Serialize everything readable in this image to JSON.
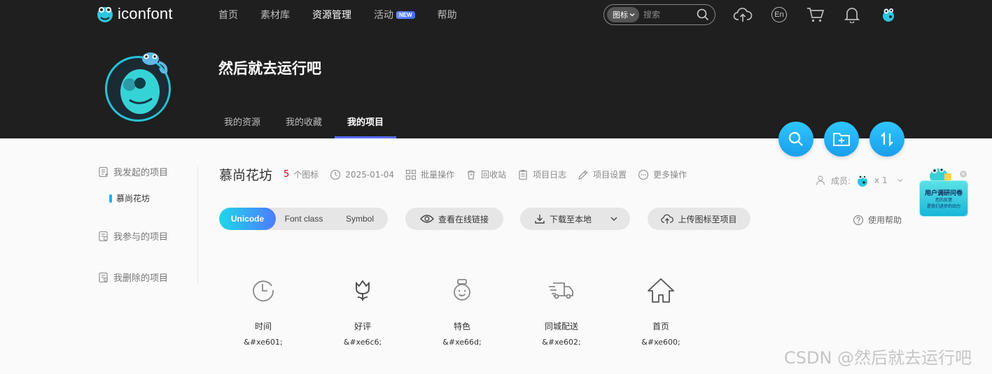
{
  "nav": {
    "logo_text": "iconfont",
    "links": [
      {
        "label": "首页"
      },
      {
        "label": "素材库"
      },
      {
        "label": "资源管理"
      },
      {
        "label": "活动",
        "badge": "NEW"
      },
      {
        "label": "帮助"
      }
    ],
    "search": {
      "type_label": "图标",
      "placeholder": "搜索"
    },
    "lang_label": "En"
  },
  "profile": {
    "name": "然后就去运行吧",
    "tabs": [
      "我的资源",
      "我的收藏",
      "我的项目"
    ],
    "active_tab": "我的项目"
  },
  "sidebar": {
    "started": "我发起的项目",
    "project_item": "慕尚花坊",
    "joined": "我参与的项目",
    "deleted": "我删除的项目"
  },
  "project": {
    "title": "慕尚花坊",
    "icon_count": "5",
    "icon_count_suffix": "个图标",
    "date": "2025-01-04",
    "actions": [
      "批量操作",
      "回收站",
      "项目日志",
      "项目设置",
      "更多操作"
    ]
  },
  "members": {
    "label": "成员:",
    "count": "x 1"
  },
  "help_label": "使用帮助",
  "toolbar": {
    "formats": [
      "Unicode",
      "Font class",
      "Symbol"
    ],
    "active_format": "Unicode",
    "view_link": "查看在线链接",
    "download": "下载至本地",
    "upload": "上传图标至项目"
  },
  "icons": [
    {
      "name": "时间",
      "code": "&#xe601;",
      "icon": "clock-icon"
    },
    {
      "name": "好评",
      "code": "&#xe6c6;",
      "icon": "tulip-icon"
    },
    {
      "name": "特色",
      "code": "&#xe66d;",
      "icon": "medal-face-icon"
    },
    {
      "name": "同城配送",
      "code": "&#xe602;",
      "icon": "delivery-truck-icon"
    },
    {
      "name": "首页",
      "code": "&#xe600;",
      "icon": "home-icon"
    }
  ],
  "survey": {
    "title": "用户调研问卷",
    "line1": "您的反馈",
    "line2": "是我们进步的动力"
  },
  "watermark": "CSDN @然后就去运行吧",
  "colors": {
    "header_bg": "#1f1f1f",
    "accent_blue": "#1ab3f3",
    "tab_underline": "#5b6bff",
    "count_red": "#d0021b",
    "page_bg": "#fafafa"
  }
}
